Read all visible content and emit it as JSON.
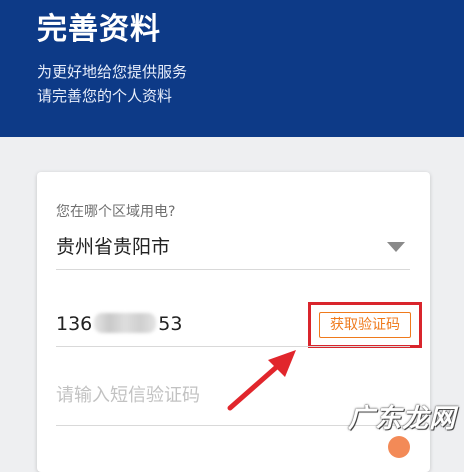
{
  "header": {
    "title": "完善资料",
    "subtitle_line1": "为更好地给您提供服务",
    "subtitle_line2": "请完善您的个人资料"
  },
  "form": {
    "region_question": "您在哪个区域用电?",
    "region_value": "贵州省贵阳市",
    "phone_prefix": "136",
    "phone_suffix": "53",
    "get_code_label": "获取验证码",
    "sms_code_placeholder": "请输入短信验证码"
  },
  "icons": {
    "dropdown": "triangle-down-icon"
  },
  "colors": {
    "header_bg": "#0d3a87",
    "code_button": "#ef7a1c",
    "highlight": "#d9252c"
  },
  "watermark": "广东龙网"
}
